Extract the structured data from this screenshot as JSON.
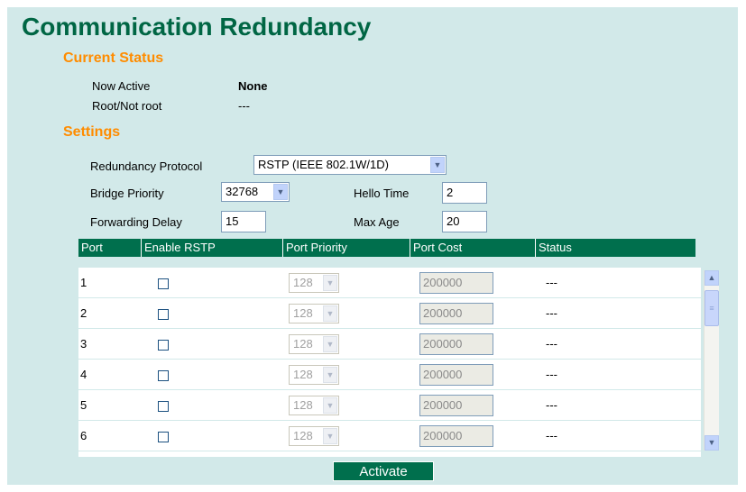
{
  "page": {
    "title": "Communication Redundancy"
  },
  "current_status": {
    "heading": "Current Status",
    "now_active_label": "Now Active",
    "now_active_value": "None",
    "root_label": "Root/Not root",
    "root_value": "---"
  },
  "settings": {
    "heading": "Settings",
    "protocol_label": "Redundancy Protocol",
    "protocol_value": "RSTP (IEEE 802.1W/1D)",
    "bridge_priority_label": "Bridge Priority",
    "bridge_priority_value": "32768",
    "hello_time_label": "Hello Time",
    "hello_time_value": "2",
    "forwarding_delay_label": "Forwarding Delay",
    "forwarding_delay_value": "15",
    "max_age_label": "Max Age",
    "max_age_value": "20"
  },
  "table": {
    "headers": [
      "Port",
      "Enable RSTP",
      "Port Priority",
      "Port Cost",
      "Status"
    ],
    "rows": [
      {
        "port": "1",
        "enabled": false,
        "priority": "128",
        "cost": "200000",
        "status": "---"
      },
      {
        "port": "2",
        "enabled": false,
        "priority": "128",
        "cost": "200000",
        "status": "---"
      },
      {
        "port": "3",
        "enabled": false,
        "priority": "128",
        "cost": "200000",
        "status": "---"
      },
      {
        "port": "4",
        "enabled": false,
        "priority": "128",
        "cost": "200000",
        "status": "---"
      },
      {
        "port": "5",
        "enabled": false,
        "priority": "128",
        "cost": "200000",
        "status": "---"
      },
      {
        "port": "6",
        "enabled": false,
        "priority": "128",
        "cost": "200000",
        "status": "---"
      }
    ]
  },
  "activate_label": "Activate",
  "icons": {
    "dropdown": "chevron-down-icon",
    "scroll_up": "scroll-up-arrow-icon",
    "scroll_down": "scroll-down-arrow-icon"
  },
  "colors": {
    "panel_bg": "#d2e9e9",
    "title": "#006644",
    "section_heading": "#ff8c00",
    "table_header_bg": "#006f4d"
  }
}
